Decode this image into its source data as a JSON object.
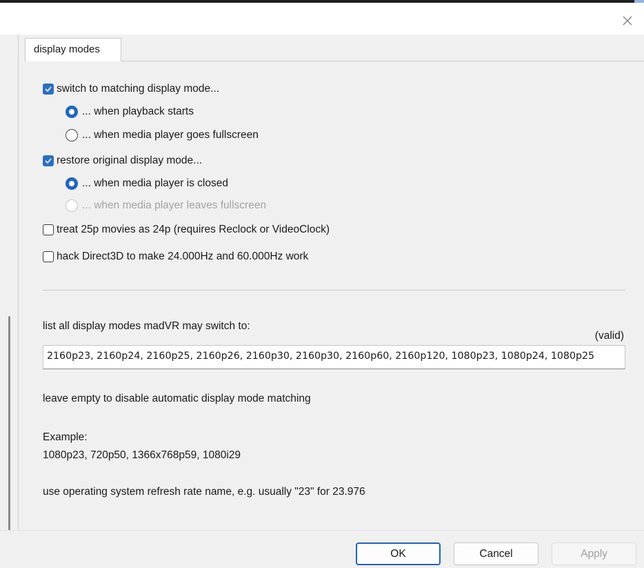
{
  "tab": {
    "label": "display modes"
  },
  "options": {
    "switch_matching": {
      "label": "switch to matching display mode...",
      "checked": true
    },
    "when_playback_starts": {
      "label": "... when playback starts",
      "selected": true
    },
    "when_fullscreen": {
      "label": "... when media player goes fullscreen",
      "selected": false
    },
    "restore_original": {
      "label": "restore original display mode...",
      "checked": true
    },
    "when_closed": {
      "label": "... when media player is closed",
      "selected": true
    },
    "when_leaves_fullscreen": {
      "label": "... when media player leaves fullscreen",
      "selected": false,
      "disabled": true
    },
    "treat_25p": {
      "label": "treat 25p movies as 24p  (requires Reclock or VideoClock)",
      "checked": false
    },
    "hack_d3d": {
      "label": "hack Direct3D to make 24.000Hz and 60.000Hz work",
      "checked": false
    }
  },
  "modes_list": {
    "label": "list all display modes madVR may switch to:",
    "status": "(valid)",
    "value": "2160p23, 2160p24, 2160p25, 2160p26, 2160p30, 2160p30, 2160p60, 2160p120, 1080p23, 1080p24, 1080p25"
  },
  "help": {
    "empty_hint": "leave empty to disable automatic display mode matching",
    "example_label": "Example:",
    "example_value": "1080p23, 720p50, 1366x768p59, 1080i29",
    "os_hint": "use operating system refresh rate name, e.g. usually \"23\" for 23.976"
  },
  "buttons": {
    "ok": "OK",
    "cancel": "Cancel",
    "apply": "Apply"
  },
  "colors": {
    "accent": "#2b6fc2",
    "panel_bg": "#f0f0f0"
  }
}
